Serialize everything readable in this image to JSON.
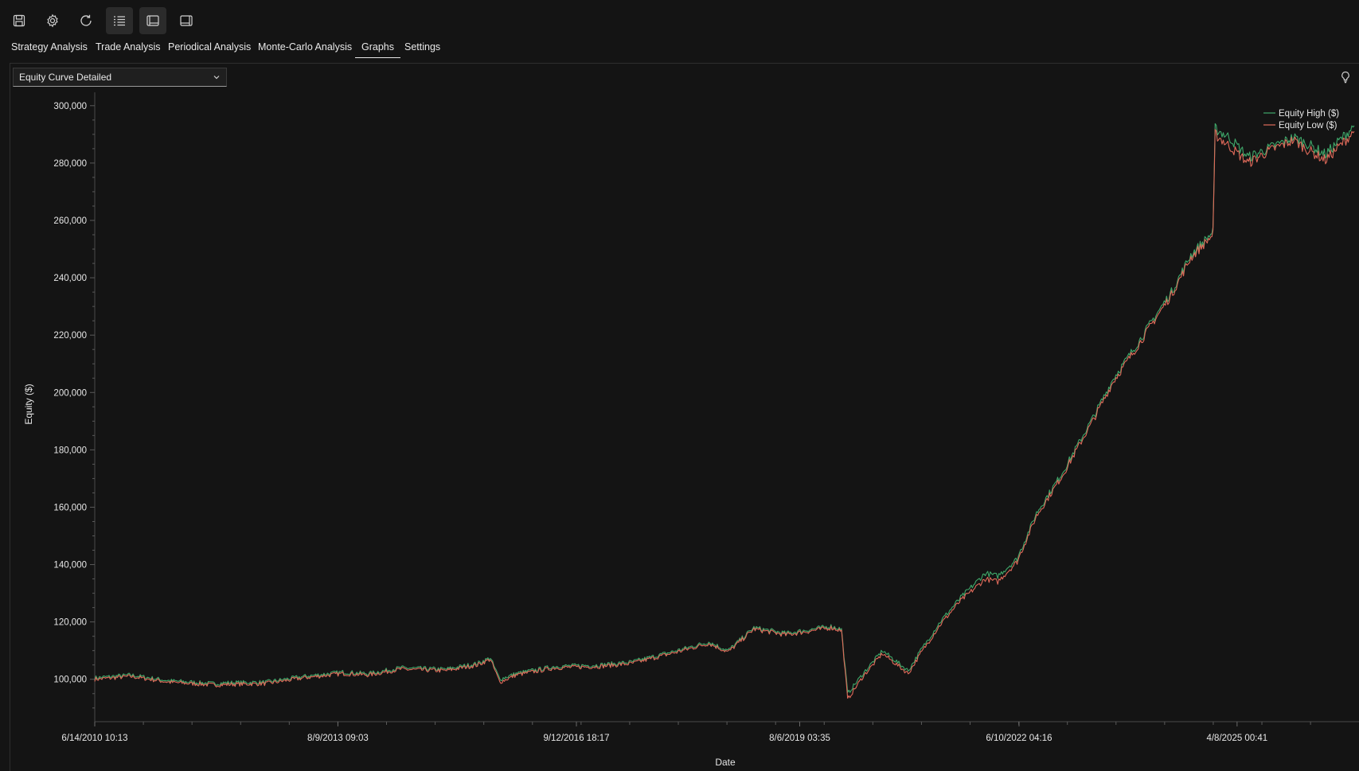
{
  "toolbar": {
    "icons": [
      "save-icon",
      "gear-icon",
      "refresh-icon",
      "list-icon",
      "panel-left-icon",
      "panel-right-icon"
    ]
  },
  "tabs": [
    {
      "label": "Strategy Analysis"
    },
    {
      "label": "Trade Analysis"
    },
    {
      "label": "Periodical Analysis"
    },
    {
      "label": "Monte-Carlo Analysis"
    },
    {
      "label": "Graphs",
      "selected": true
    },
    {
      "label": "Settings"
    }
  ],
  "graph_selector": {
    "value": "Equity Curve Detailed"
  },
  "colors": {
    "background": "#141414",
    "equity_high": "#3fa86a",
    "equity_low": "#e06a5a",
    "axis": "#5a5a5a",
    "text": "#e6e6e6"
  },
  "chart_data": {
    "type": "line",
    "title": "",
    "xlabel": "Date",
    "ylabel": "Equity ($)",
    "ylim": [
      88000,
      303000
    ],
    "xlim": [
      "2010-06-14",
      "2026-10-15"
    ],
    "yticks": [
      100000,
      120000,
      140000,
      160000,
      180000,
      200000,
      220000,
      240000,
      260000,
      280000,
      300000
    ],
    "ytick_labels": [
      "100,000",
      "120,000",
      "140,000",
      "160,000",
      "180,000",
      "200,000",
      "220,000",
      "240,000",
      "260,000",
      "280,000",
      "300,000"
    ],
    "xticks": [
      "2010-06-14",
      "2013-08-09",
      "2016-09-12",
      "2019-08-06",
      "2022-06-10",
      "2025-04-08"
    ],
    "xtick_labels": [
      "6/14/2010 10:13",
      "8/9/2013 09:03",
      "9/12/2016 18:17",
      "8/6/2019 03:35",
      "6/10/2022 04:16",
      "4/8/2025 00:41"
    ],
    "legend_position": "top-right",
    "grid": false,
    "series": [
      {
        "name": "Equity High ($)",
        "x": [
          "2010-06-14",
          "2010-12-01",
          "2011-06-01",
          "2012-01-01",
          "2012-03-01",
          "2012-09-01",
          "2013-03-01",
          "2013-09-01",
          "2014-01-01",
          "2014-06-01",
          "2015-01-01",
          "2015-06-01",
          "2015-08-01",
          "2015-09-15",
          "2015-12-01",
          "2016-06-01",
          "2017-01-01",
          "2017-06-01",
          "2018-01-01",
          "2018-06-01",
          "2018-09-01",
          "2019-01-01",
          "2019-06-01",
          "2020-01-01",
          "2020-02-20",
          "2020-03-20",
          "2020-06-01",
          "2020-09-01",
          "2021-01-01",
          "2021-03-01",
          "2021-06-01",
          "2021-09-01",
          "2022-01-01",
          "2022-03-01",
          "2022-06-01",
          "2022-09-01",
          "2023-01-01",
          "2023-06-01",
          "2023-09-01",
          "2024-01-01",
          "2024-03-01",
          "2024-06-01",
          "2024-09-01",
          "2024-12-15",
          "2024-12-25",
          "2025-03-01",
          "2025-06-01",
          "2025-09-01",
          "2026-01-01",
          "2026-03-01",
          "2026-06-01",
          "2026-10-15"
        ],
        "y": [
          100500,
          101500,
          99500,
          98500,
          98800,
          99000,
          101000,
          102500,
          102000,
          104000,
          103500,
          105500,
          107500,
          100000,
          102000,
          104500,
          105000,
          106000,
          110000,
          113000,
          110000,
          118000,
          116000,
          118500,
          117500,
          95000,
          102000,
          110000,
          103000,
          110000,
          120000,
          128000,
          137000,
          136000,
          142000,
          158000,
          172000,
          192000,
          205000,
          218000,
          225000,
          235000,
          248000,
          256000,
          292000,
          289000,
          282000,
          285000,
          289000,
          287000,
          283000,
          293000
        ]
      },
      {
        "name": "Equity Low ($)",
        "x": [
          "2010-06-14",
          "2010-12-01",
          "2011-06-01",
          "2012-01-01",
          "2012-03-01",
          "2012-09-01",
          "2013-03-01",
          "2013-09-01",
          "2014-01-01",
          "2014-06-01",
          "2015-01-01",
          "2015-06-01",
          "2015-08-01",
          "2015-09-15",
          "2015-12-01",
          "2016-06-01",
          "2017-01-01",
          "2017-06-01",
          "2018-01-01",
          "2018-06-01",
          "2018-09-01",
          "2019-01-01",
          "2019-06-01",
          "2020-01-01",
          "2020-02-20",
          "2020-03-20",
          "2020-06-01",
          "2020-09-01",
          "2021-01-01",
          "2021-03-01",
          "2021-06-01",
          "2021-09-01",
          "2022-01-01",
          "2022-03-01",
          "2022-06-01",
          "2022-09-01",
          "2023-01-01",
          "2023-06-01",
          "2023-09-01",
          "2024-01-01",
          "2024-03-01",
          "2024-06-01",
          "2024-09-01",
          "2024-12-15",
          "2024-12-25",
          "2025-03-01",
          "2025-06-01",
          "2025-09-01",
          "2026-01-01",
          "2026-03-01",
          "2026-06-01",
          "2026-10-15"
        ],
        "y": [
          100000,
          101000,
          99000,
          98000,
          98200,
          98500,
          100500,
          102000,
          101500,
          103500,
          103000,
          105000,
          107000,
          99000,
          101500,
          104000,
          104500,
          105500,
          109500,
          112500,
          109500,
          117500,
          115500,
          118000,
          117000,
          93000,
          101000,
          109000,
          102000,
          109000,
          119000,
          127000,
          135000,
          134000,
          141000,
          157000,
          171000,
          191000,
          204000,
          217000,
          224000,
          234000,
          247000,
          255000,
          290000,
          286000,
          280000,
          284000,
          288000,
          285000,
          281000,
          291000
        ]
      }
    ]
  }
}
